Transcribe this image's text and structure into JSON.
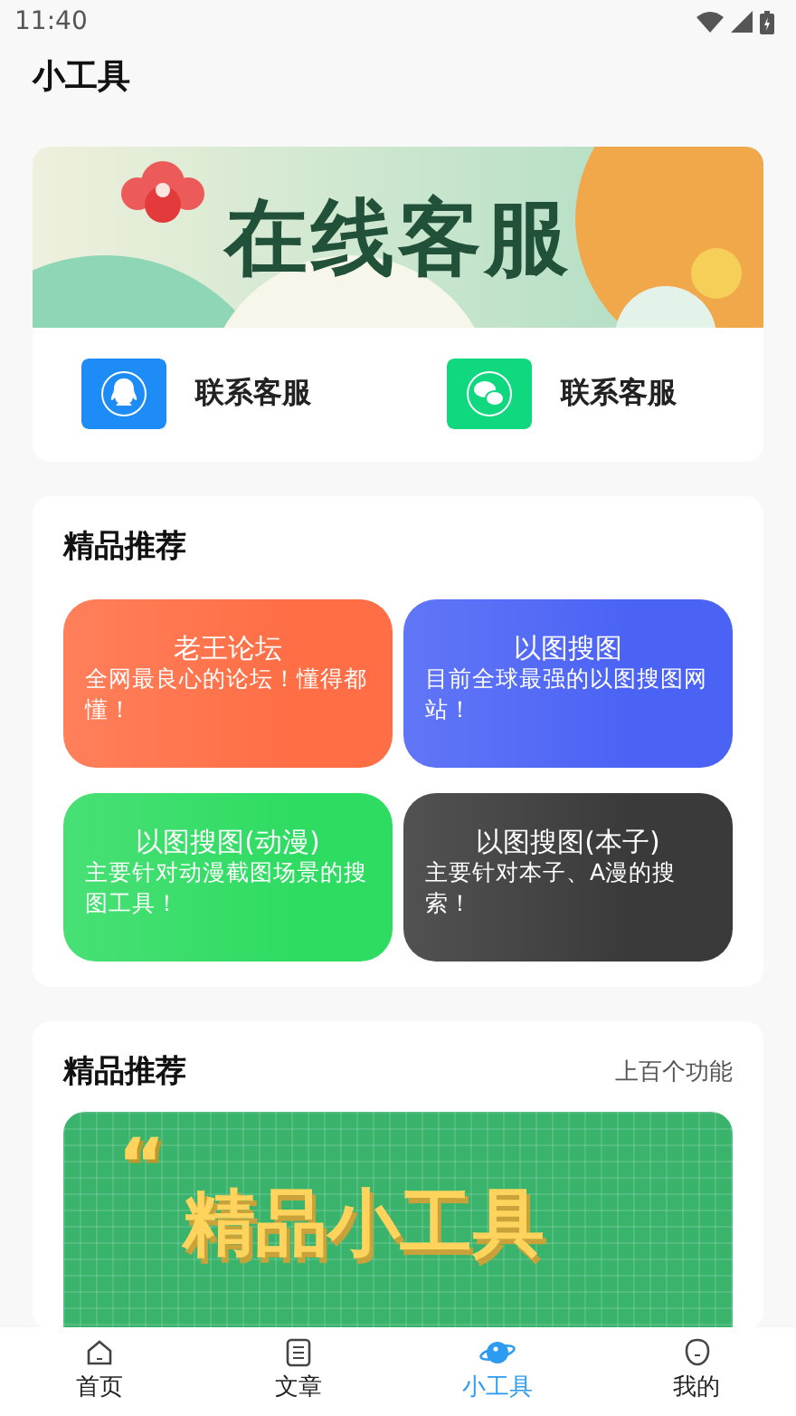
{
  "status_bar": {
    "time": "11:40"
  },
  "header": {
    "title": "小工具"
  },
  "service_card": {
    "banner_title": "在线客服",
    "contacts": [
      {
        "kind": "qq",
        "label": "联系客服"
      },
      {
        "kind": "wechat",
        "label": "联系客服"
      }
    ]
  },
  "featured": {
    "title": "精品推荐",
    "tiles": [
      {
        "title": "老王论坛",
        "description": "全网最良心的论坛！懂得都懂！",
        "color": "#ff6e45"
      },
      {
        "title": "以图搜图",
        "description": "目前全球最强的以图搜图网站！",
        "color": "#4b63f5"
      },
      {
        "title": "以图搜图(动漫)",
        "description": "主要针对动漫截图场景的搜图工具！",
        "color": "#2fdc62"
      },
      {
        "title": "以图搜图(本子)",
        "description": "主要针对本子、A漫的搜索！",
        "color": "#3a3a3a"
      }
    ]
  },
  "tools_card": {
    "title": "精品推荐",
    "link": "上百个功能",
    "banner_quote": "“",
    "banner_title": "精品小工具"
  },
  "bottom_nav": [
    {
      "kind": "home",
      "label": "首页",
      "selected": false
    },
    {
      "kind": "article",
      "label": "文章",
      "selected": false
    },
    {
      "kind": "tools",
      "label": "小工具",
      "selected": true
    },
    {
      "kind": "profile",
      "label": "我的",
      "selected": false
    }
  ]
}
